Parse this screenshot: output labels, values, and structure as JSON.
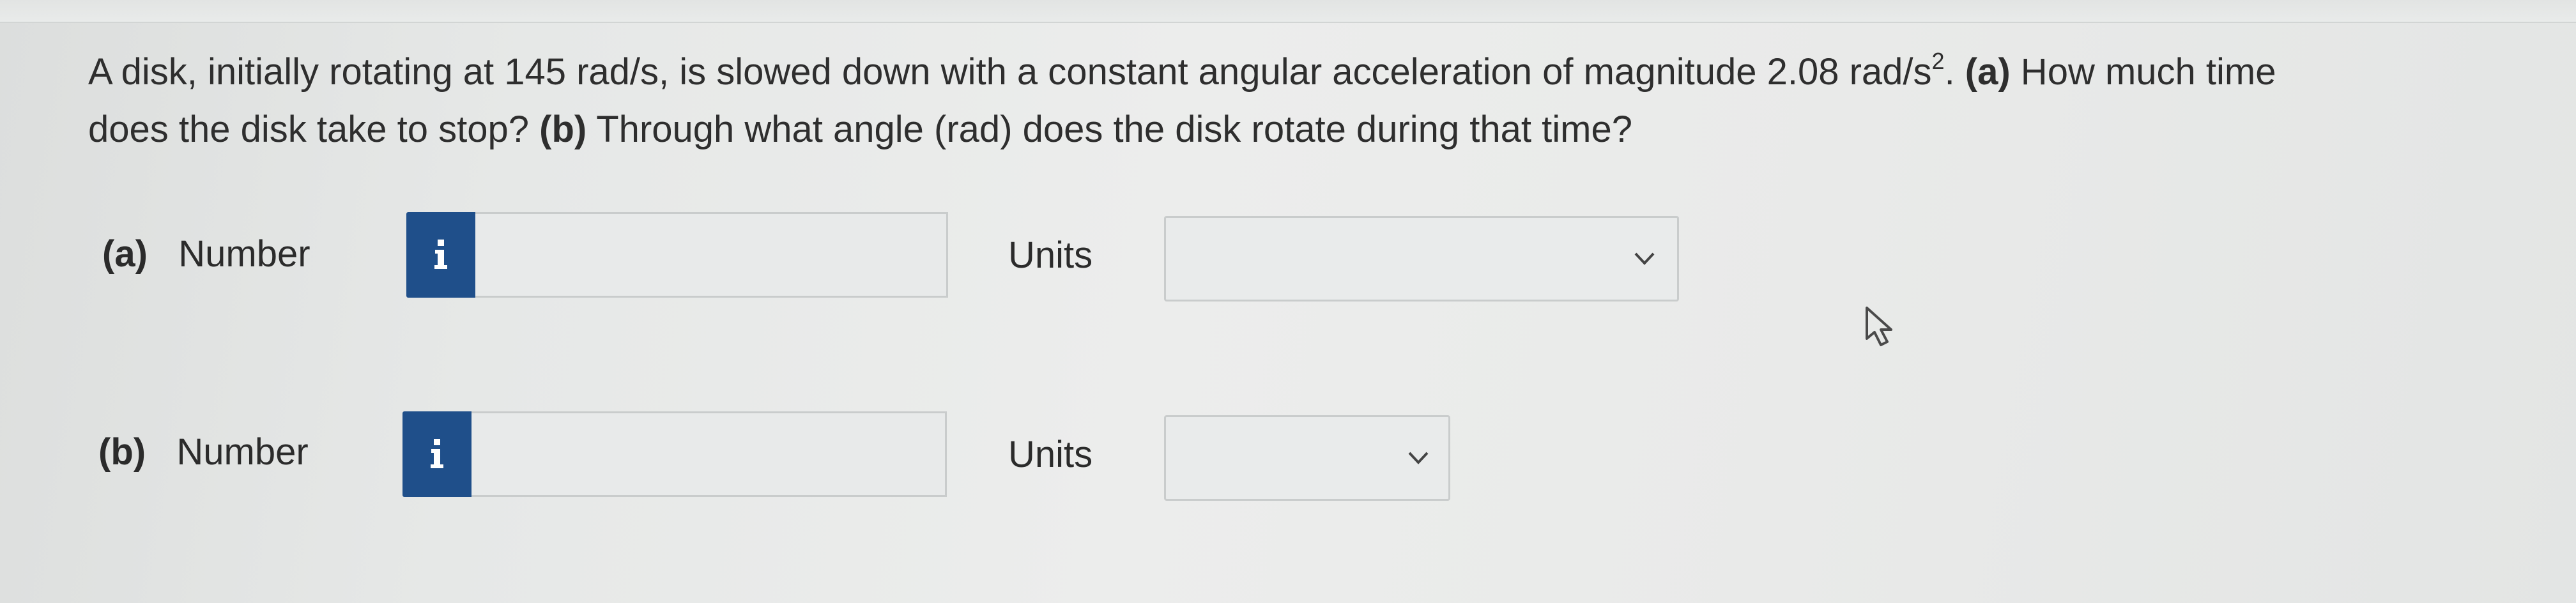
{
  "question": {
    "line1_prefix": "A disk, initially rotating at 145 rad/s, is slowed down with a constant angular acceleration of magnitude 2.08 rad/s",
    "line1_sup": "2",
    "line1_after_sup": ". ",
    "line1_part_a": "(a)",
    "line1_suffix": " How much time",
    "line2_prefix": "does the disk take to stop? ",
    "line2_part_b": "(b)",
    "line2_suffix": " Through what angle (rad) does the disk rotate during that time?"
  },
  "parts": [
    {
      "letter": "(a)",
      "number_label": "Number",
      "info_icon": "info-icon",
      "number_value": "",
      "units_label": "Units",
      "units_selected": ""
    },
    {
      "letter": "(b)",
      "number_label": "Number",
      "info_icon": "info-icon",
      "number_value": "",
      "units_label": "Units",
      "units_selected": ""
    }
  ],
  "colors": {
    "info_badge": "#1f4f8a",
    "background": "#e6e8e7",
    "text": "#2b2b2b"
  }
}
